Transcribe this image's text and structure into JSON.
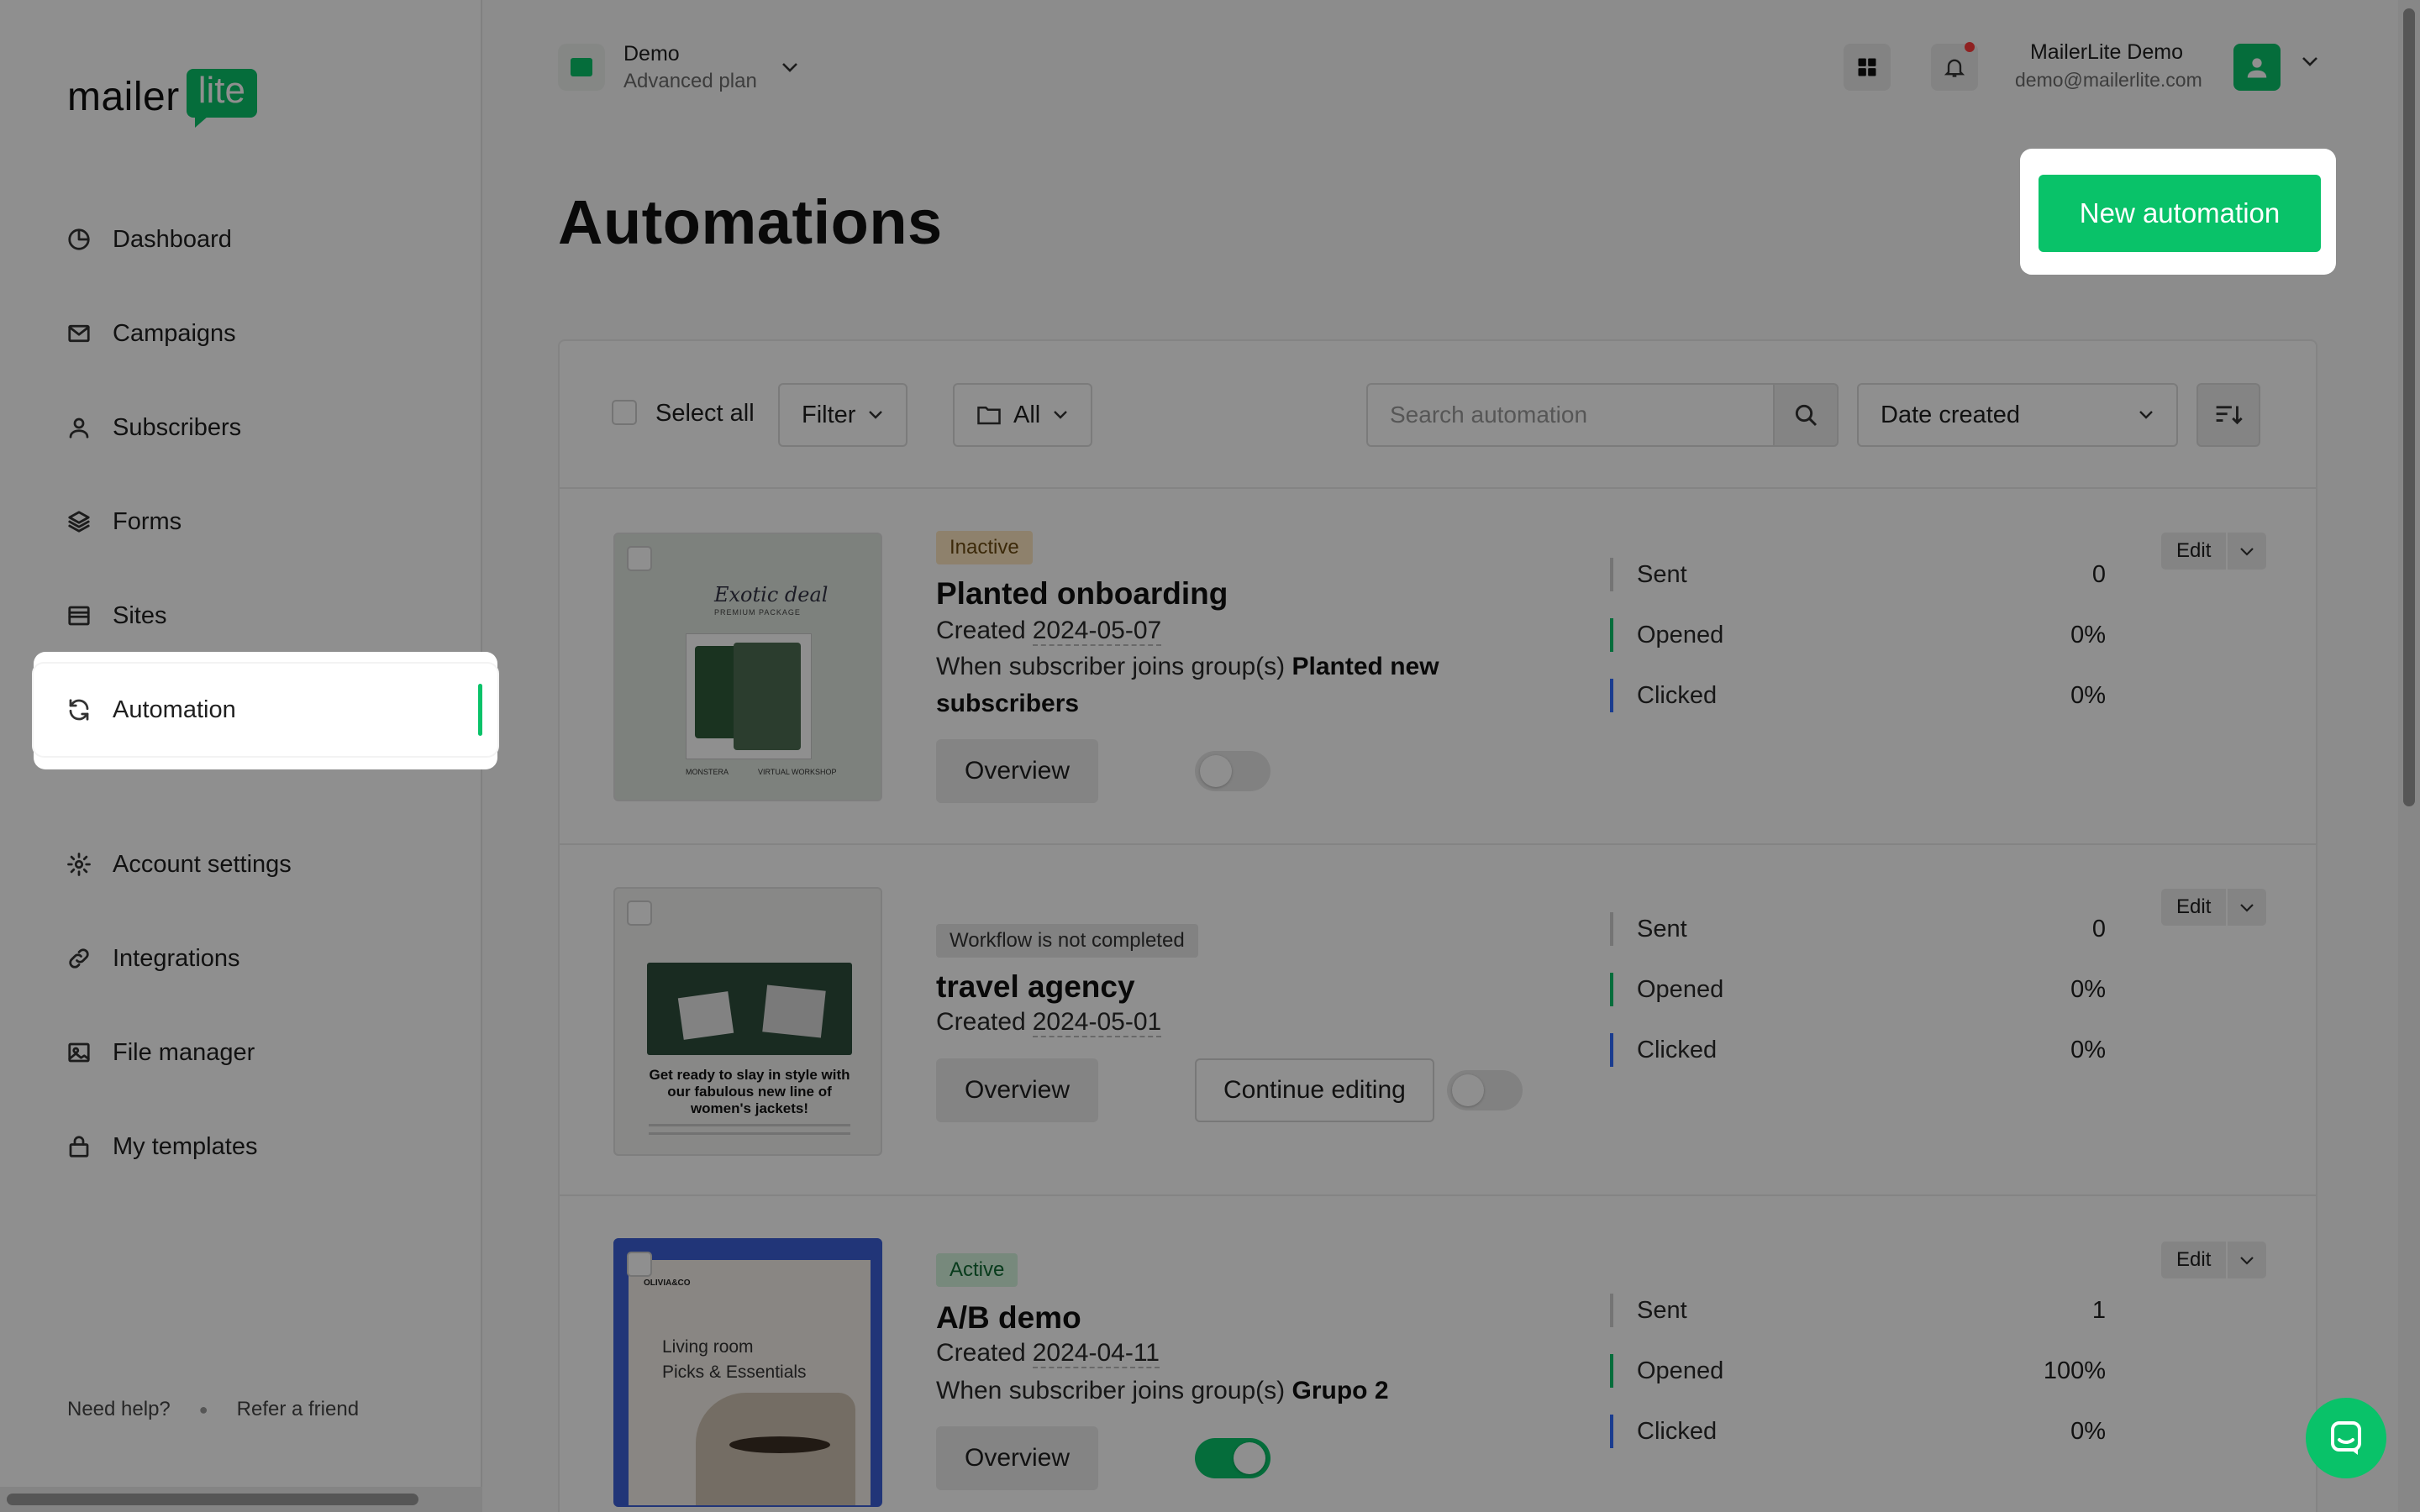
{
  "logo": {
    "word": "mailer",
    "badge": "lite"
  },
  "sidebar": {
    "items": [
      {
        "label": "Dashboard",
        "icon": "dashboard-icon"
      },
      {
        "label": "Campaigns",
        "icon": "envelope-icon"
      },
      {
        "label": "Subscribers",
        "icon": "user-icon"
      },
      {
        "label": "Forms",
        "icon": "layers-icon"
      },
      {
        "label": "Sites",
        "icon": "browser-icon"
      },
      {
        "label": "Automation",
        "icon": "refresh-icon",
        "active": true
      },
      {
        "label": "Account settings",
        "icon": "gear-icon"
      },
      {
        "label": "Integrations",
        "icon": "link-icon"
      },
      {
        "label": "File manager",
        "icon": "image-icon"
      },
      {
        "label": "My templates",
        "icon": "lock-icon"
      }
    ],
    "footer": {
      "help": "Need help?",
      "refer": "Refer a friend"
    }
  },
  "header": {
    "account_name": "Demo",
    "account_plan": "Advanced plan",
    "user_name": "MailerLite Demo",
    "user_email": "demo@mailerlite.com"
  },
  "page": {
    "title": "Automations",
    "new_button": "New automation"
  },
  "toolbar": {
    "select_all": "Select all",
    "filter": "Filter",
    "folder": "All",
    "search_placeholder": "Search automation",
    "sort": "Date created"
  },
  "automations": [
    {
      "status": "Inactive",
      "title": "Planted onboarding",
      "created_label": "Created",
      "created": "2024-05-07",
      "trigger_prefix": "When subscriber joins group(s)",
      "trigger_group": "Planted new subscribers",
      "overview": "Overview",
      "enabled": false,
      "stats": {
        "sent_label": "Sent",
        "sent": "0",
        "opened_label": "Opened",
        "opened": "0%",
        "clicked_label": "Clicked",
        "clicked": "0%"
      },
      "edit": "Edit",
      "thumb": {
        "script": "Exotic deal",
        "caption": "PREMIUM PACKAGE",
        "tag1": "MONSTERA",
        "tag2": "VIRTUAL WORKSHOP"
      }
    },
    {
      "status": "Workflow is not completed",
      "title": "travel agency",
      "created_label": "Created",
      "created": "2024-05-01",
      "overview": "Overview",
      "continue": "Continue editing",
      "enabled": false,
      "stats": {
        "sent_label": "Sent",
        "sent": "0",
        "opened_label": "Opened",
        "opened": "0%",
        "clicked_label": "Clicked",
        "clicked": "0%"
      },
      "edit": "Edit",
      "thumb": {
        "headline": "Get ready to slay in style with our fabulous new line of women's jackets!"
      }
    },
    {
      "status": "Active",
      "title": "A/B demo",
      "created_label": "Created",
      "created": "2024-04-11",
      "trigger_prefix": "When subscriber joins group(s)",
      "trigger_group": "Grupo 2",
      "overview": "Overview",
      "enabled": true,
      "stats": {
        "sent_label": "Sent",
        "sent": "1",
        "opened_label": "Opened",
        "opened": "100%",
        "clicked_label": "Clicked",
        "clicked": "0%"
      },
      "edit": "Edit",
      "thumb": {
        "brand": "OLIVIA&CO",
        "line1": "Living room",
        "line2": "Picks & Essentials"
      }
    }
  ],
  "colors": {
    "brand": "#09c269",
    "overlay": "rgba(0,0,0,0.44)"
  }
}
